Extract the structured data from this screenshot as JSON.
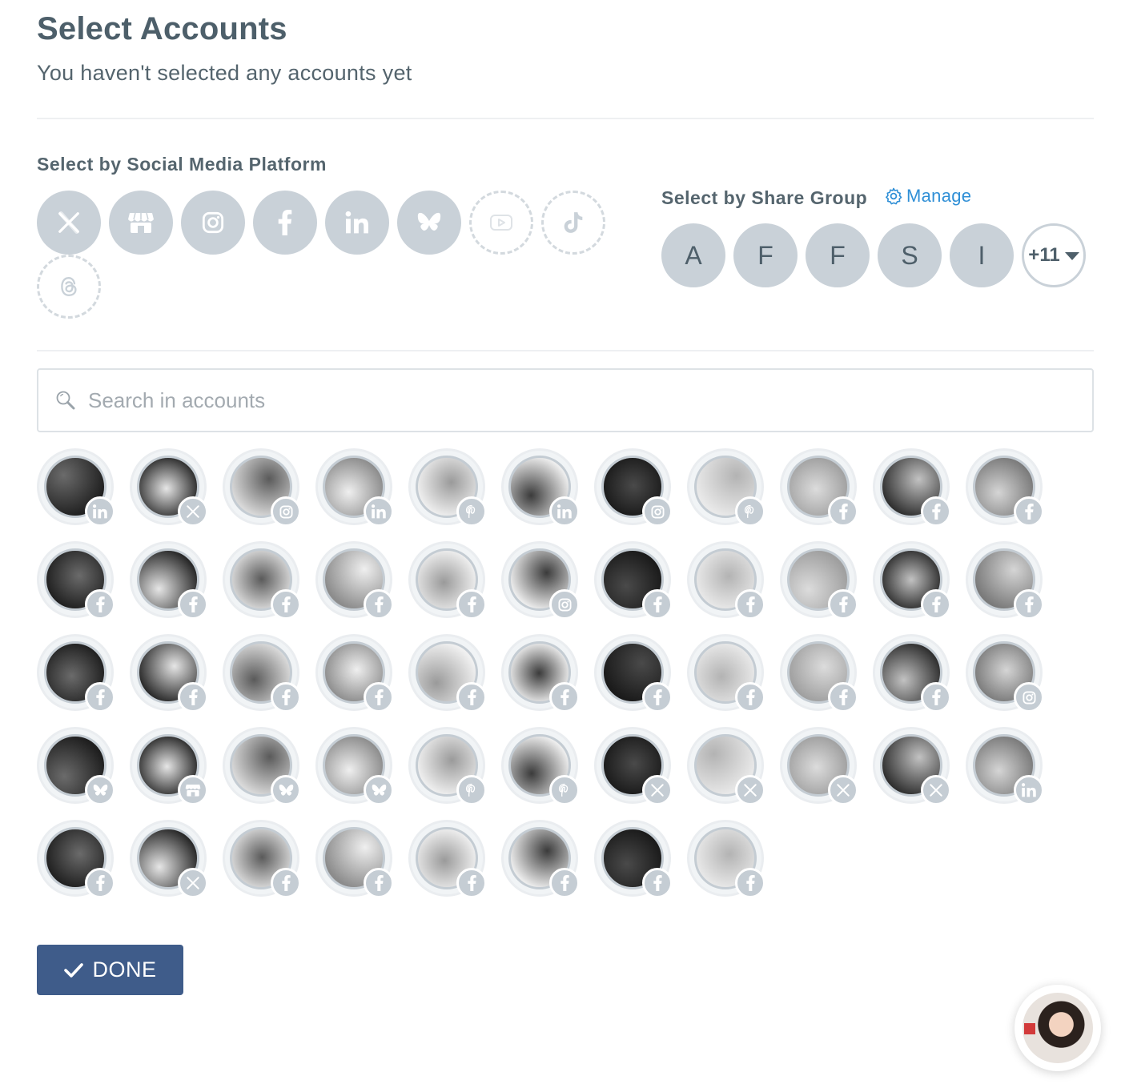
{
  "header": {
    "title": "Select Accounts",
    "subtitle": "You haven't selected any accounts yet"
  },
  "platform_section": {
    "title": "Select by Social Media Platform",
    "platforms": [
      {
        "name": "x",
        "icon": "x-icon",
        "state": "available"
      },
      {
        "name": "google-business",
        "icon": "storefront-icon",
        "state": "available"
      },
      {
        "name": "instagram",
        "icon": "instagram-icon",
        "state": "available"
      },
      {
        "name": "facebook",
        "icon": "facebook-icon",
        "state": "available"
      },
      {
        "name": "linkedin",
        "icon": "linkedin-icon",
        "state": "available"
      },
      {
        "name": "bluesky",
        "icon": "bluesky-icon",
        "state": "available"
      },
      {
        "name": "youtube",
        "icon": "youtube-icon",
        "state": "unavailable"
      },
      {
        "name": "tiktok",
        "icon": "tiktok-icon",
        "state": "unavailable"
      },
      {
        "name": "threads",
        "icon": "threads-icon",
        "state": "unavailable"
      }
    ]
  },
  "share_group_section": {
    "title": "Select by Share Group",
    "manage_label": "Manage",
    "groups": [
      "A",
      "F",
      "F",
      "S",
      "I"
    ],
    "more_label": "+11"
  },
  "search": {
    "placeholder": "Search in accounts",
    "value": ""
  },
  "accounts": [
    {
      "platform": "linkedin",
      "avatar": "marketing-bulb"
    },
    {
      "platform": "x",
      "avatar": "cat"
    },
    {
      "platform": "instagram",
      "avatar": "woman-portrait"
    },
    {
      "platform": "linkedin",
      "avatar": "woman-smiling"
    },
    {
      "platform": "pinterest",
      "avatar": "woman-sitting"
    },
    {
      "platform": "linkedin",
      "avatar": "woman-glasses"
    },
    {
      "platform": "instagram",
      "avatar": "dark-moon"
    },
    {
      "platform": "pinterest",
      "avatar": "woman-light"
    },
    {
      "platform": "facebook",
      "avatar": "cityscape"
    },
    {
      "platform": "facebook",
      "avatar": "basketball-players"
    },
    {
      "platform": "facebook",
      "avatar": "garden"
    },
    {
      "platform": "facebook",
      "avatar": "audience-writing"
    },
    {
      "platform": "facebook",
      "avatar": "phone-apps"
    },
    {
      "platform": "facebook",
      "avatar": "checklist"
    },
    {
      "platform": "facebook",
      "avatar": "flowers"
    },
    {
      "platform": "facebook",
      "avatar": "social-media-words"
    },
    {
      "platform": "instagram",
      "avatar": "person-glasses"
    },
    {
      "platform": "facebook",
      "avatar": "field"
    },
    {
      "platform": "facebook",
      "avatar": "laptop"
    },
    {
      "platform": "facebook",
      "avatar": "woman-dark-hair"
    },
    {
      "platform": "facebook",
      "avatar": "woman-dark-hair-2"
    },
    {
      "platform": "facebook",
      "avatar": "garden-2"
    },
    {
      "platform": "facebook",
      "avatar": "marketing-text"
    },
    {
      "platform": "facebook",
      "avatar": "building"
    },
    {
      "platform": "facebook",
      "avatar": "game-controller"
    },
    {
      "platform": "facebook",
      "avatar": "boy-glasses"
    },
    {
      "platform": "facebook",
      "avatar": "coffee"
    },
    {
      "platform": "facebook",
      "avatar": "pencil-cup"
    },
    {
      "platform": "facebook",
      "avatar": "ring"
    },
    {
      "platform": "facebook",
      "avatar": "jewelry"
    },
    {
      "platform": "facebook",
      "avatar": "laptop-2"
    },
    {
      "platform": "facebook",
      "avatar": "like-notification"
    },
    {
      "platform": "instagram",
      "avatar": "wheel"
    },
    {
      "platform": "bluesky",
      "avatar": "woman-painting"
    },
    {
      "platform": "google-business",
      "avatar": "smile-logo"
    },
    {
      "platform": "bluesky",
      "avatar": "woman-striped"
    },
    {
      "platform": "bluesky",
      "avatar": "man-suit"
    },
    {
      "platform": "pinterest",
      "avatar": "older-man"
    },
    {
      "platform": "pinterest",
      "avatar": "man-curly"
    },
    {
      "platform": "x",
      "avatar": "woman-snow"
    },
    {
      "platform": "x",
      "avatar": "woman-glasses-2"
    },
    {
      "platform": "x",
      "avatar": "dark-sign"
    },
    {
      "platform": "x",
      "avatar": "woman-striped-2"
    },
    {
      "platform": "linkedin",
      "avatar": "yoga"
    },
    {
      "platform": "facebook",
      "avatar": "ring-2"
    },
    {
      "platform": "x",
      "avatar": "woman-dark"
    },
    {
      "platform": "facebook",
      "avatar": "squirrel"
    },
    {
      "platform": "facebook",
      "avatar": "side-hustle"
    },
    {
      "platform": "facebook",
      "avatar": "machine"
    },
    {
      "platform": "facebook",
      "avatar": "silhouettes"
    },
    {
      "platform": "facebook",
      "avatar": "technology"
    },
    {
      "platform": "facebook",
      "avatar": "books"
    }
  ],
  "done_button": {
    "label": "DONE"
  },
  "chat_widget": {
    "icon": "support-avatar"
  },
  "colors": {
    "platform_bg": "#c9d1d8",
    "accent_link": "#2f8fd6",
    "done_bg": "#3f5c8a",
    "text": "#4d5f6a"
  }
}
